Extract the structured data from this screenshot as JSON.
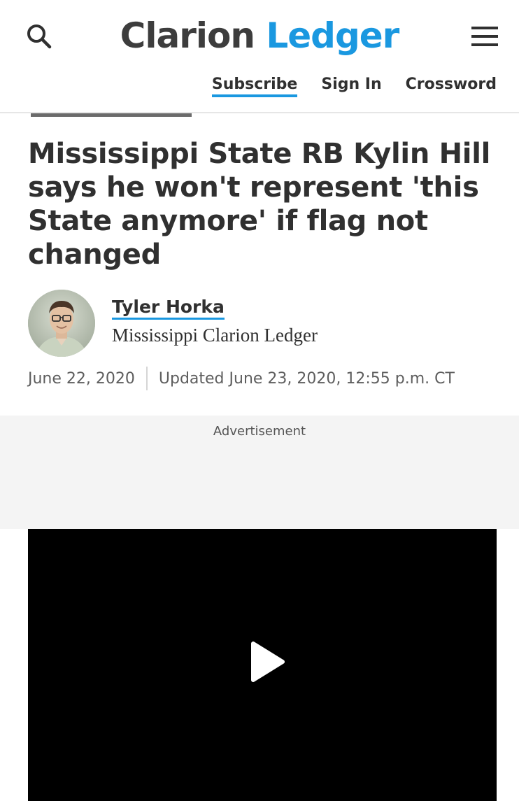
{
  "header": {
    "logo_word1": "Clarion",
    "logo_word2": "Ledger",
    "search_icon": "search-icon",
    "menu_icon": "hamburger-menu-icon",
    "nav": {
      "subscribe": "Subscribe",
      "sign_in": "Sign In",
      "crossword": "Crossword"
    }
  },
  "article": {
    "headline": "Mississippi State RB Kylin Hill says he won't represent 'this State anymore' if flag not changed",
    "author": "Tyler Horka",
    "organization": "Mississippi Clarion Ledger",
    "published": "June 22, 2020",
    "updated": "Updated June 23, 2020, 12:55 p.m. CT"
  },
  "ad": {
    "label": "Advertisement"
  },
  "video": {
    "play_icon": "play-icon"
  },
  "colors": {
    "brand_blue": "#1a98e0",
    "text_dark": "#303030",
    "meta_gray": "#5e5e5e"
  }
}
